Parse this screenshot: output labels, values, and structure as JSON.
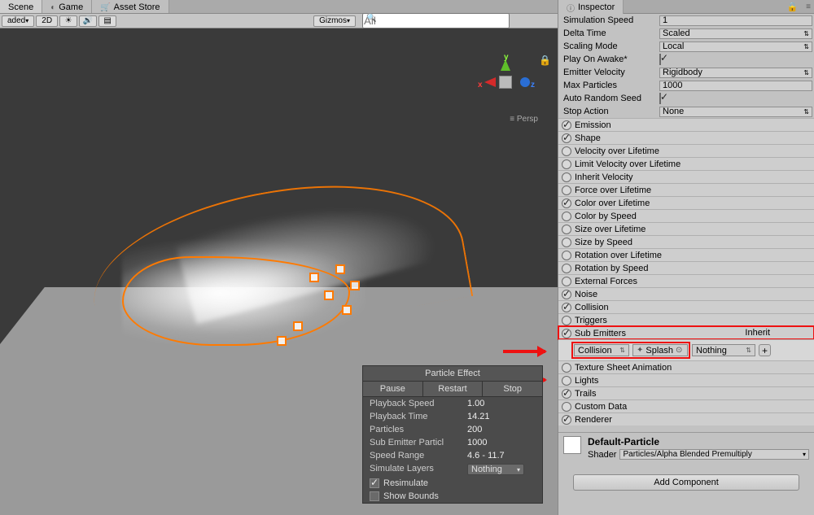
{
  "tabs": {
    "scene": "Scene",
    "game": "Game",
    "asset_store": "Asset Store"
  },
  "scene_toolbar": {
    "shaded": "aded",
    "twoD": "2D",
    "gizmos": "Gizmos",
    "search_placeholder": "All"
  },
  "persp_label": "Persp",
  "axis": {
    "x": "x",
    "y": "y",
    "z": "z"
  },
  "particle_overlay": {
    "title": "Particle Effect",
    "pause": "Pause",
    "restart": "Restart",
    "stop": "Stop",
    "rows": {
      "playback_speed": {
        "label": "Playback Speed",
        "value": "1.00"
      },
      "playback_time": {
        "label": "Playback Time",
        "value": "14.21"
      },
      "particles": {
        "label": "Particles",
        "value": "200"
      },
      "sub_emitter_particles": {
        "label": "Sub Emitter Particl",
        "value": "1000"
      },
      "speed_range": {
        "label": "Speed Range",
        "value": "4.6 - 11.7"
      },
      "simulate_layers": {
        "label": "Simulate Layers",
        "value": "Nothing"
      },
      "resimulate": {
        "label": "Resimulate",
        "checked": true
      },
      "show_bounds": {
        "label": "Show Bounds",
        "checked": false
      }
    }
  },
  "inspector": {
    "title": "Inspector",
    "props": {
      "simulation_speed": {
        "label": "Simulation Speed",
        "value": "1"
      },
      "delta_time": {
        "label": "Delta Time",
        "value": "Scaled"
      },
      "scaling_mode": {
        "label": "Scaling Mode",
        "value": "Local"
      },
      "play_on_awake": {
        "label": "Play On Awake*",
        "checked": true
      },
      "emitter_velocity": {
        "label": "Emitter Velocity",
        "value": "Rigidbody"
      },
      "max_particles": {
        "label": "Max Particles",
        "value": "1000"
      },
      "auto_random_seed": {
        "label": "Auto Random Seed",
        "checked": true
      },
      "stop_action": {
        "label": "Stop Action",
        "value": "None"
      }
    },
    "modules": [
      {
        "name": "Emission",
        "on": true
      },
      {
        "name": "Shape",
        "on": true
      },
      {
        "name": "Velocity over Lifetime",
        "on": false
      },
      {
        "name": "Limit Velocity over Lifetime",
        "on": false
      },
      {
        "name": "Inherit Velocity",
        "on": false
      },
      {
        "name": "Force over Lifetime",
        "on": false
      },
      {
        "name": "Color over Lifetime",
        "on": true
      },
      {
        "name": "Color by Speed",
        "on": false
      },
      {
        "name": "Size over Lifetime",
        "on": false
      },
      {
        "name": "Size by Speed",
        "on": false
      },
      {
        "name": "Rotation over Lifetime",
        "on": false
      },
      {
        "name": "Rotation by Speed",
        "on": false
      },
      {
        "name": "External Forces",
        "on": false
      },
      {
        "name": "Noise",
        "on": true
      },
      {
        "name": "Collision",
        "on": true
      },
      {
        "name": "Triggers",
        "on": false
      },
      {
        "name": "Sub Emitters",
        "on": true
      },
      {
        "name": "Texture Sheet Animation",
        "on": false
      },
      {
        "name": "Lights",
        "on": false
      },
      {
        "name": "Trails",
        "on": true
      },
      {
        "name": "Custom Data",
        "on": false
      },
      {
        "name": "Renderer",
        "on": true
      }
    ],
    "sub_emitters": {
      "condition": "Collision",
      "object": "Splash",
      "inherit_label": "Inherit",
      "inherit_value": "Nothing"
    },
    "material": {
      "name": "Default-Particle",
      "shader_label": "Shader",
      "shader_value": "Particles/Alpha Blended Premultiply"
    },
    "add_component": "Add Component"
  }
}
